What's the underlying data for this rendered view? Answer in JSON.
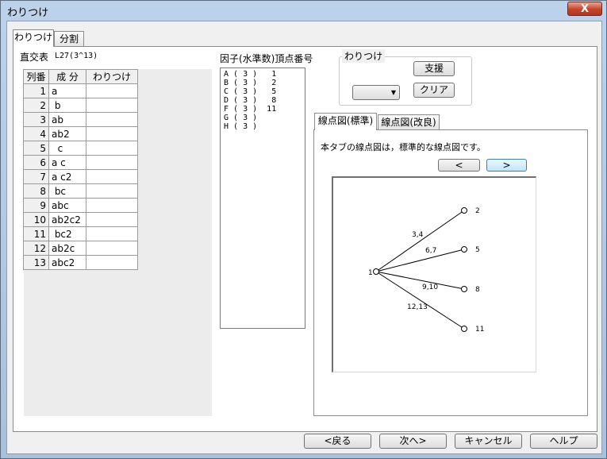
{
  "window": {
    "title": "わりつけ",
    "close_label": "X"
  },
  "tabs": [
    {
      "label": "わりつけ"
    },
    {
      "label": "分割"
    }
  ],
  "orthogonal_table": {
    "label": "直交表",
    "value": "L27(3^13)"
  },
  "column_table": {
    "headers": [
      "列番",
      "成 分",
      "わりつけ"
    ],
    "rows": [
      {
        "num": "1",
        "component": "a",
        "alloc": ""
      },
      {
        "num": "2",
        "component": " b",
        "alloc": ""
      },
      {
        "num": "3",
        "component": "ab",
        "alloc": ""
      },
      {
        "num": "4",
        "component": "ab2",
        "alloc": ""
      },
      {
        "num": "5",
        "component": "  c",
        "alloc": ""
      },
      {
        "num": "6",
        "component": "a c",
        "alloc": ""
      },
      {
        "num": "7",
        "component": "a c2",
        "alloc": ""
      },
      {
        "num": "8",
        "component": " bc",
        "alloc": ""
      },
      {
        "num": "9",
        "component": "abc",
        "alloc": ""
      },
      {
        "num": "10",
        "component": "ab2c2",
        "alloc": ""
      },
      {
        "num": "11",
        "component": " bc2",
        "alloc": ""
      },
      {
        "num": "12",
        "component": "ab2c",
        "alloc": ""
      },
      {
        "num": "13",
        "component": "abc2",
        "alloc": ""
      }
    ]
  },
  "factor_list": {
    "label": "因子(水準数)頂点番号",
    "items": [
      "A ( 3 )   1",
      "B ( 3 )   2",
      "C ( 3 )   5",
      "D ( 3 )   8",
      "F ( 3 )  11",
      "G ( 3 )",
      "H ( 3 )"
    ]
  },
  "allocation_group": {
    "label": "わりつけ",
    "support_button": "支援",
    "clear_button": "クリア",
    "dropdown_value": ""
  },
  "graph_tabs": [
    {
      "label": "線点図(標準)"
    },
    {
      "label": "線点図(改良)"
    }
  ],
  "graph_description": "本タブの線点図は，標準的な線点図です。",
  "nav": {
    "prev": "<",
    "next": ">"
  },
  "linear_graph": {
    "center_label": "1",
    "branches": [
      {
        "node": "2",
        "edge": "3,4"
      },
      {
        "node": "5",
        "edge": "6,7"
      },
      {
        "node": "8",
        "edge": "9,10"
      },
      {
        "node": "11",
        "edge": "12,13"
      }
    ]
  },
  "footer": {
    "back": "<戻る",
    "next": "次へ>",
    "cancel": "キャンセル",
    "help": "ヘルプ"
  }
}
